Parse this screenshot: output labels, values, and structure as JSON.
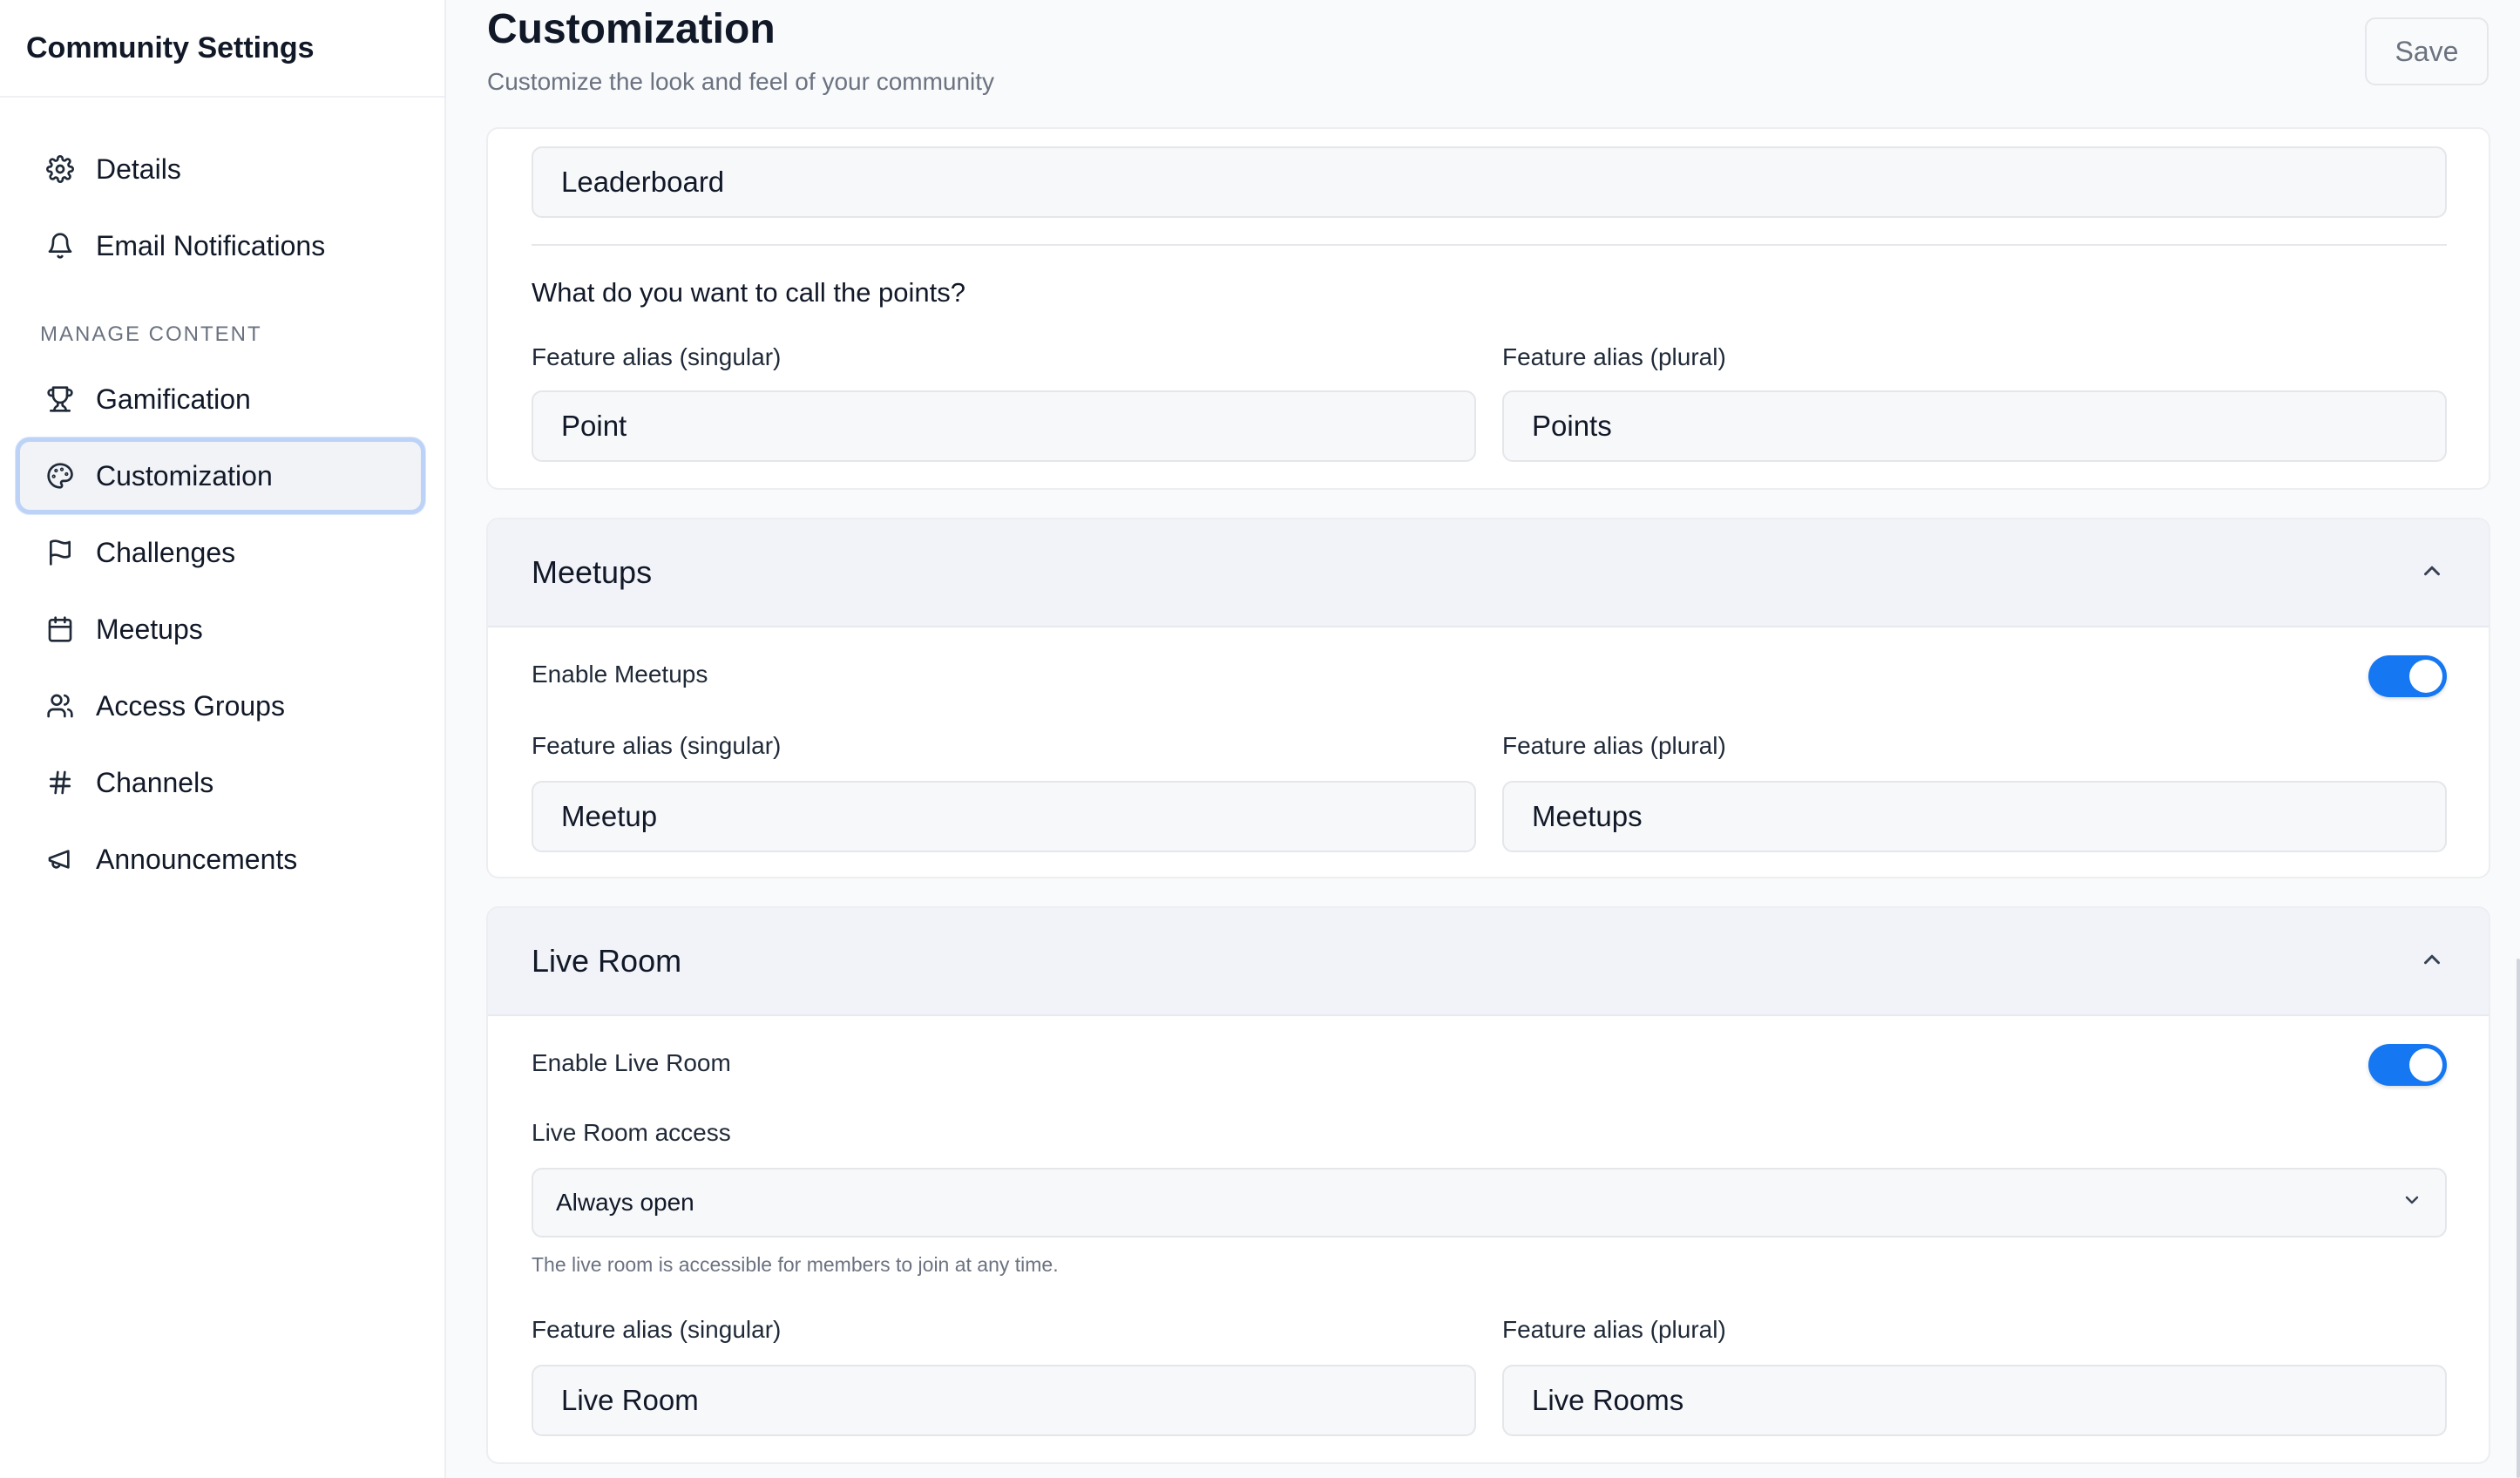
{
  "sidebar": {
    "title": "Community Settings",
    "section_label": "MANAGE CONTENT",
    "items": [
      {
        "label": "Details",
        "icon": "gear-icon"
      },
      {
        "label": "Email Notifications",
        "icon": "bell-icon"
      },
      {
        "label": "Gamification",
        "icon": "trophy-icon"
      },
      {
        "label": "Customization",
        "icon": "palette-icon",
        "active": true
      },
      {
        "label": "Challenges",
        "icon": "flag-icon"
      },
      {
        "label": "Meetups",
        "icon": "calendar-icon"
      },
      {
        "label": "Access Groups",
        "icon": "users-icon"
      },
      {
        "label": "Channels",
        "icon": "hash-icon"
      },
      {
        "label": "Announcements",
        "icon": "megaphone-icon"
      }
    ]
  },
  "header": {
    "title": "Customization",
    "subtitle": "Customize the look and feel of your community",
    "save_label": "Save"
  },
  "leaderboard": {
    "value": "Leaderboard",
    "points_question": "What do you want to call the points?",
    "singular_label": "Feature alias (singular)",
    "plural_label": "Feature alias (plural)",
    "singular_value": "Point",
    "plural_value": "Points"
  },
  "meetups": {
    "title": "Meetups",
    "enable_label": "Enable Meetups",
    "enabled": true,
    "singular_label": "Feature alias (singular)",
    "plural_label": "Feature alias (plural)",
    "singular_value": "Meetup",
    "plural_value": "Meetups"
  },
  "live_room": {
    "title": "Live Room",
    "enable_label": "Enable Live Room",
    "enabled": true,
    "access_label": "Live Room access",
    "access_value": "Always open",
    "access_helper": "The live room is accessible for members to join at any time.",
    "singular_label": "Feature alias (singular)",
    "plural_label": "Feature alias (plural)",
    "singular_value": "Live Room",
    "plural_value": "Live Rooms"
  },
  "colors": {
    "accent": "#1677f2",
    "active_border": "#bcd3f7",
    "card_header_bg": "#f1f3f8"
  }
}
